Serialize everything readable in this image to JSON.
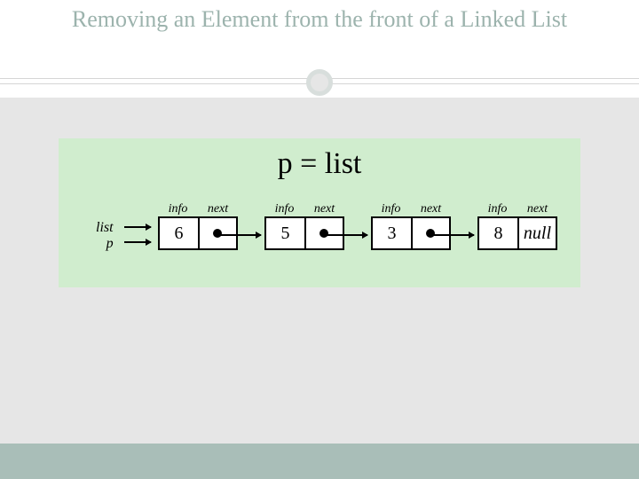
{
  "title": "Removing an Element from the front of a Linked List",
  "diagram": {
    "equation": "p = list",
    "pointers": [
      "list",
      "p"
    ],
    "column_labels": {
      "left": "info",
      "right": "next"
    },
    "null_label": "null",
    "nodes": [
      {
        "info": "6",
        "next": "dot"
      },
      {
        "info": "5",
        "next": "dot"
      },
      {
        "info": "3",
        "next": "dot"
      },
      {
        "info": "8",
        "next": "null"
      }
    ]
  }
}
